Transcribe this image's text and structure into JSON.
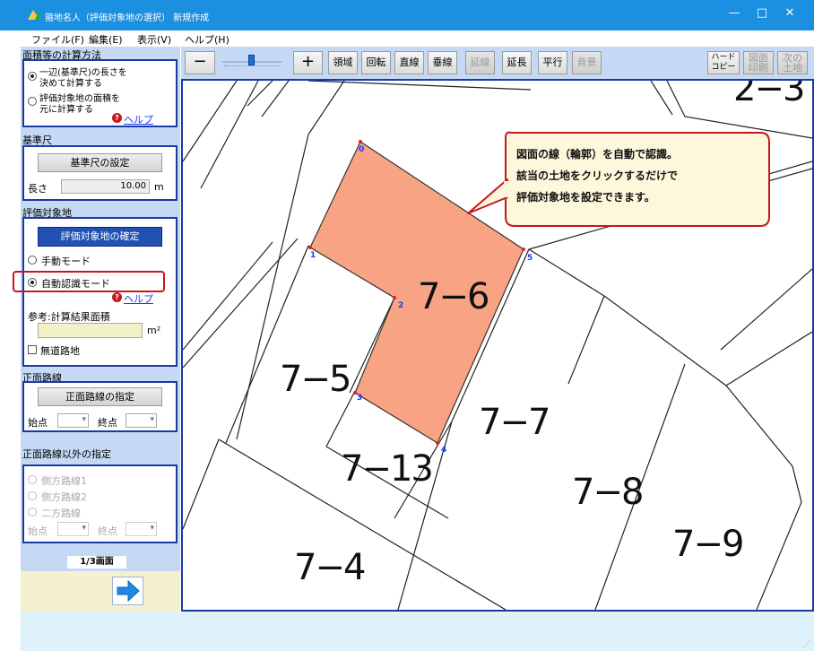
{
  "window": {
    "title": "箍地名人（評価対象地の選択） 新規作成",
    "minimize": "—",
    "maximize": "□",
    "close": "✕"
  },
  "menu": [
    "ファイル(F)",
    "編集(E)",
    "表示(V)",
    "ヘルプ(H)"
  ],
  "left_panel": {
    "calc_method": {
      "title": "面積等の計算方法",
      "option1": "一辺(基準尺)の長さを決めて計算する",
      "option1_line1": "一辺(基準尺)の長さを",
      "option1_line2": "決めて計算する",
      "option2_line1": "評価対象地の面積を",
      "option2_line2": "元に計算する",
      "selected": "option1",
      "help": "ヘルプ"
    },
    "scale": {
      "title": "基準尺",
      "button": "基準尺の設定",
      "length_label": "長さ",
      "length_value": "10.00",
      "unit": "m"
    },
    "target": {
      "title": "評価対象地",
      "confirm_button": "評価対象地の確定",
      "manual_mode": "手動モード",
      "auto_mode": "自動認識モード",
      "selected": "auto_mode",
      "help": "ヘルプ",
      "area_label": "参考:計算結果面積",
      "area_value": "",
      "area_unit": "m²",
      "no_road_label": "無道路地",
      "no_road_checked": false
    },
    "frontage": {
      "title": "正面路線",
      "button": "正面路線の指定",
      "start_label": "始点",
      "end_label": "終点"
    },
    "other_frontage": {
      "title": "正面路線以外の指定",
      "options": [
        "側方路線1",
        "側方路線2",
        "二方路線"
      ],
      "start_label": "始点",
      "end_label": "終点"
    },
    "page_indicator": "1/3画面",
    "next_icon": "arrow-right-icon"
  },
  "toolbar": {
    "zoom_out": "−",
    "zoom_in": "+",
    "zoom_level": 0.5,
    "buttons": [
      "領域",
      "回転",
      "直線",
      "垂線",
      "延線",
      "延長",
      "平行",
      "背景"
    ],
    "disabled_buttons": [
      "延線",
      "背景"
    ],
    "hard_copy_line1": "ハード",
    "hard_copy_line2": "コピー",
    "print_line1": "図面",
    "print_line2": "印刷",
    "next_land_line1": "次の",
    "next_land_line2": "土地"
  },
  "map": {
    "lots": [
      "7−6",
      "7−5",
      "7−7",
      "7−13",
      "7−8",
      "7−9",
      "7−4",
      "2−3"
    ],
    "vertices": [
      "0",
      "1",
      "2",
      "3",
      "4",
      "5"
    ],
    "selected_lot": "7−6",
    "selected_color": "#f7a384",
    "callout_lines": [
      "図面の線（輪郭）を自動で認識。",
      "該当の土地をクリックするだけで",
      "評価対象地を設定できます。"
    ]
  },
  "colors": {
    "titlebar": "#1b8fe0",
    "panel": "#c5d9f5",
    "accent": "#1a3aa0",
    "highlight": "#c8161d"
  }
}
